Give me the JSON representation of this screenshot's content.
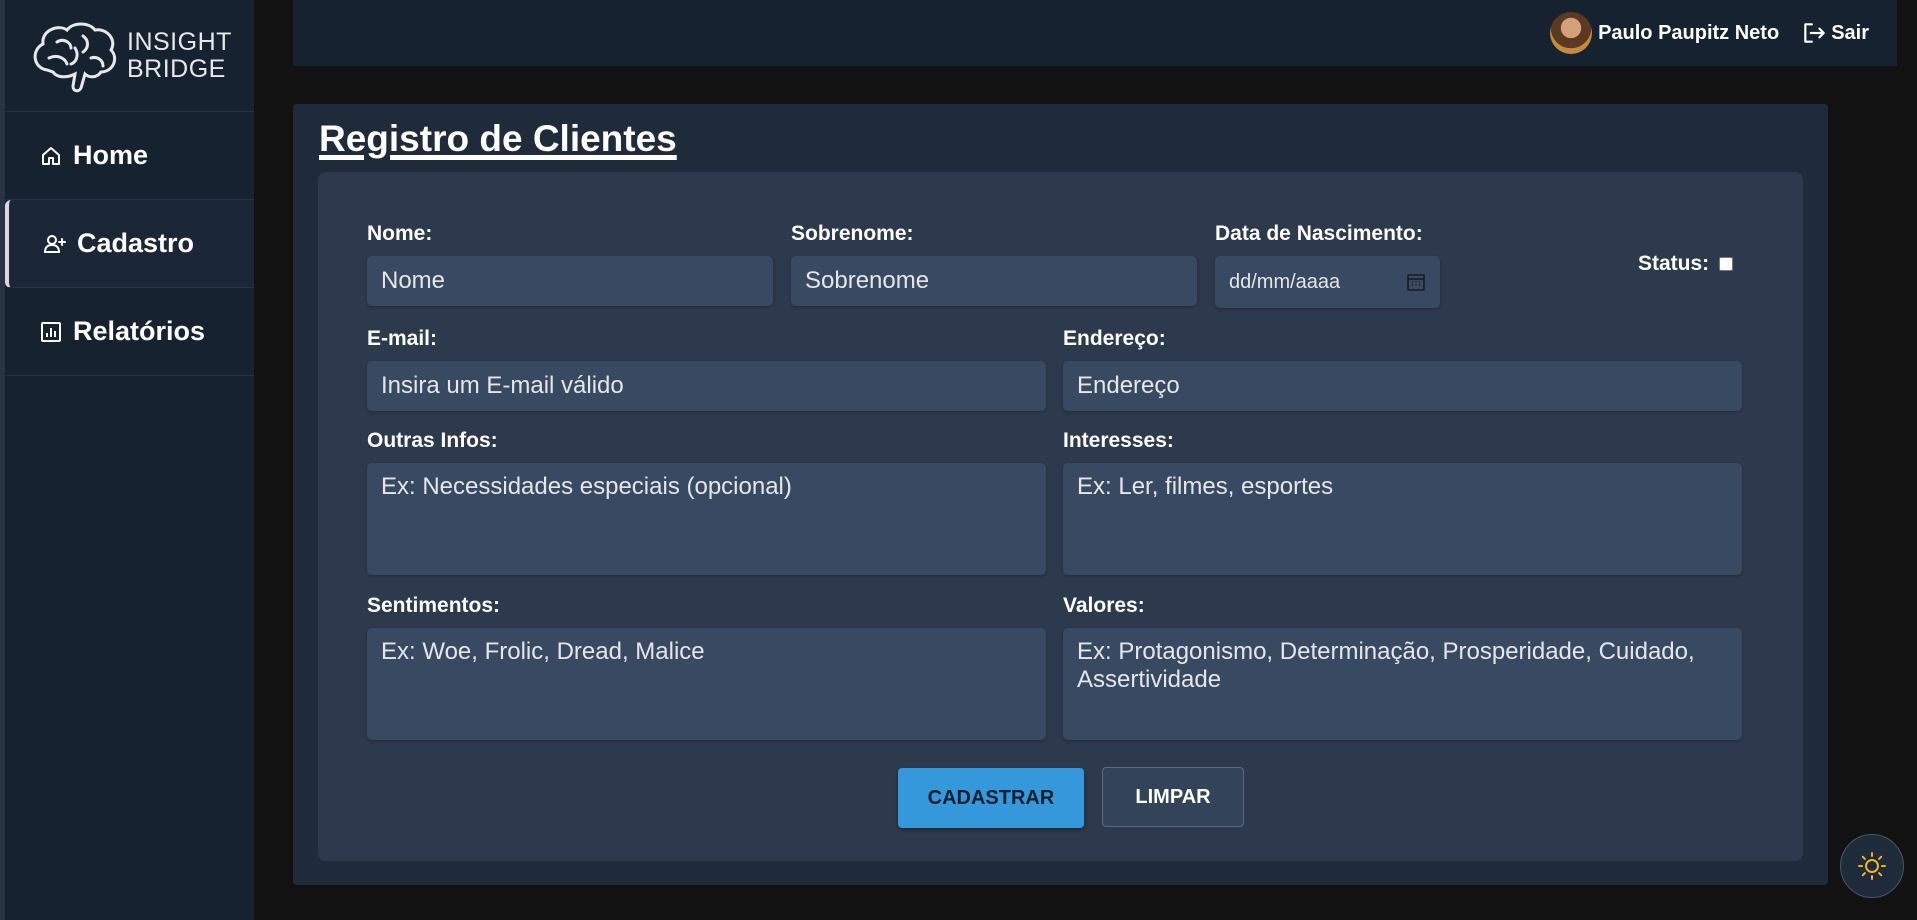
{
  "brand": {
    "line1": "INSIGHT",
    "line2": "BRIDGE"
  },
  "sidebar": {
    "items": [
      {
        "label": "Home",
        "icon": "home-icon"
      },
      {
        "label": "Cadastro",
        "icon": "add-user-icon",
        "active": true
      },
      {
        "label": "Relatórios",
        "icon": "bar-chart-icon"
      }
    ]
  },
  "topbar": {
    "user_name": "Paulo Paupitz Neto",
    "logout_label": "Sair"
  },
  "page": {
    "title": "Registro de Clientes"
  },
  "form": {
    "nome": {
      "label": "Nome:",
      "placeholder": "Nome"
    },
    "sobrenome": {
      "label": "Sobrenome:",
      "placeholder": "Sobrenome"
    },
    "nascimento": {
      "label": "Data de Nascimento:",
      "placeholder": "dd/mm/aaaa"
    },
    "status": {
      "label": "Status:",
      "checked": false
    },
    "email": {
      "label": "E-mail:",
      "placeholder": "Insira um E-mail válido"
    },
    "endereco": {
      "label": "Endereço:",
      "placeholder": "Endereço"
    },
    "outras_infos": {
      "label": "Outras Infos:",
      "placeholder": "Ex: Necessidades especiais (opcional)"
    },
    "interesses": {
      "label": "Interesses:",
      "placeholder": "Ex: Ler, filmes, esportes"
    },
    "sentimentos": {
      "label": "Sentimentos:",
      "placeholder": "Ex: Woe, Frolic, Dread, Malice"
    },
    "valores": {
      "label": "Valores:",
      "placeholder": "Ex: Protagonismo, Determinação, Prosperidade, Cuidado, Assertividade"
    },
    "submit_label": "CADASTRAR",
    "clear_label": "LIMPAR"
  },
  "colors": {
    "primary": "#3498db",
    "panel": "#2d3a4d",
    "input": "#374a62",
    "sun": "#f0b429"
  }
}
